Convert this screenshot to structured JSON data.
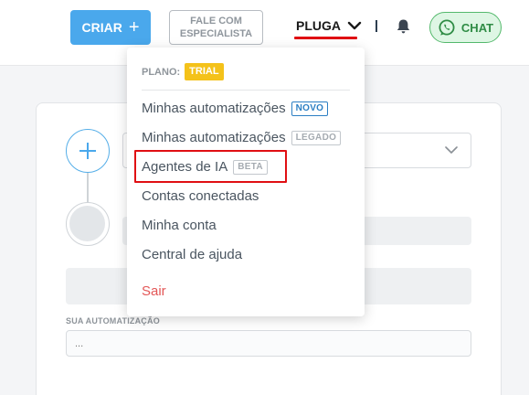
{
  "topbar": {
    "create_label": "CRIAR",
    "specialist_line1": "FALE COM",
    "specialist_line2": "ESPECIALISTA",
    "account_name": "PLUGA",
    "chat_label": "CHAT"
  },
  "editor": {
    "field_label": "SUA AUTOMATIZAÇÃO",
    "field_placeholder": "..."
  },
  "menu": {
    "plan_label": "PLANO:",
    "plan_badge": "TRIAL",
    "items": [
      {
        "label": "Minhas automatizações",
        "tag": "NOVO"
      },
      {
        "label": "Minhas automatizações",
        "tag": "LEGADO"
      },
      {
        "label": "Agentes de IA",
        "tag": "BETA"
      },
      {
        "label": "Contas conectadas"
      },
      {
        "label": "Minha conta"
      },
      {
        "label": "Central de ajuda"
      },
      {
        "label": "Sair"
      }
    ]
  },
  "colors": {
    "primary": "#4aa8ec",
    "highlight": "#e00f13",
    "trial_badge": "#f4c21a",
    "logout": "#e35757",
    "chat_green": "#2f8c45"
  },
  "icons": {
    "create": "plus-icon",
    "account_toggle": "chevron-down-icon",
    "notifications": "bell-icon",
    "chat": "whatsapp-icon",
    "add_step": "plus-icon",
    "select_toggle": "chevron-down-icon"
  }
}
